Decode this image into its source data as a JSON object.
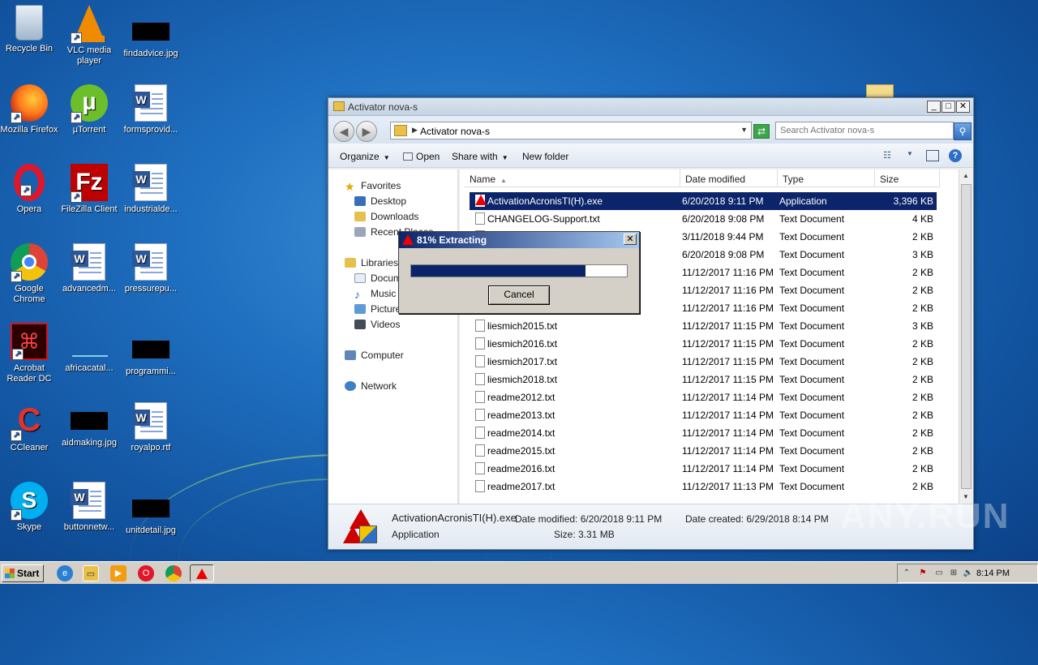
{
  "desktop": {
    "icons": [
      {
        "label": "Recycle Bin"
      },
      {
        "label": "VLC media player"
      },
      {
        "label": "findadvice.jpg"
      },
      {
        "label": "Mozilla Firefox"
      },
      {
        "label": "µTorrent"
      },
      {
        "label": "formsprovid..."
      },
      {
        "label": "Opera"
      },
      {
        "label": "FileZilla Client"
      },
      {
        "label": "industrialde..."
      },
      {
        "label": "Google Chrome"
      },
      {
        "label": "advancedm..."
      },
      {
        "label": "pressurepu..."
      },
      {
        "label": "Acrobat Reader DC"
      },
      {
        "label": "africacatal..."
      },
      {
        "label": "programmi..."
      },
      {
        "label": "CCleaner"
      },
      {
        "label": "aidmaking.jpg"
      },
      {
        "label": "royalpo.rtf"
      },
      {
        "label": "Skype"
      },
      {
        "label": "buttonnetw..."
      },
      {
        "label": "unitdetail.jpg"
      }
    ]
  },
  "explorer": {
    "title": "Activator nova-s",
    "address": "Activator nova-s",
    "search_placeholder": "Search Activator nova-s",
    "toolbar": {
      "organize": "Organize",
      "open": "Open",
      "share_with": "Share with",
      "new_folder": "New folder"
    },
    "nav": {
      "favorites": "Favorites",
      "desktop": "Desktop",
      "downloads": "Downloads",
      "recent_places": "Recent Places",
      "libraries": "Libraries",
      "documents": "Docum",
      "music": "Music",
      "pictures": "Picture",
      "videos": "Videos",
      "computer": "Computer",
      "network": "Network"
    },
    "columns": {
      "name": "Name",
      "date": "Date modified",
      "type": "Type",
      "size": "Size"
    },
    "files": [
      {
        "name": "ActivationAcronisTI(H).exe",
        "date": "6/20/2018 9:11 PM",
        "type": "Application",
        "size": "3,396 KB"
      },
      {
        "name": "CHANGELOG-Support.txt",
        "date": "6/20/2018 9:08 PM",
        "type": "Text Document",
        "size": "4 KB"
      },
      {
        "name": "",
        "date": "3/11/2018 9:44 PM",
        "type": "Text Document",
        "size": "2 KB"
      },
      {
        "name": "",
        "date": "6/20/2018 9:08 PM",
        "type": "Text Document",
        "size": "3 KB"
      },
      {
        "name": "",
        "date": "11/12/2017 11:16 PM",
        "type": "Text Document",
        "size": "2 KB"
      },
      {
        "name": "",
        "date": "11/12/2017 11:16 PM",
        "type": "Text Document",
        "size": "2 KB"
      },
      {
        "name": "",
        "date": "11/12/2017 11:16 PM",
        "type": "Text Document",
        "size": "2 KB"
      },
      {
        "name": "liesmich2015.txt",
        "date": "11/12/2017 11:15 PM",
        "type": "Text Document",
        "size": "3 KB"
      },
      {
        "name": "liesmich2016.txt",
        "date": "11/12/2017 11:15 PM",
        "type": "Text Document",
        "size": "2 KB"
      },
      {
        "name": "liesmich2017.txt",
        "date": "11/12/2017 11:15 PM",
        "type": "Text Document",
        "size": "2 KB"
      },
      {
        "name": "liesmich2018.txt",
        "date": "11/12/2017 11:15 PM",
        "type": "Text Document",
        "size": "2 KB"
      },
      {
        "name": "readme2012.txt",
        "date": "11/12/2017 11:14 PM",
        "type": "Text Document",
        "size": "2 KB"
      },
      {
        "name": "readme2013.txt",
        "date": "11/12/2017 11:14 PM",
        "type": "Text Document",
        "size": "2 KB"
      },
      {
        "name": "readme2014.txt",
        "date": "11/12/2017 11:14 PM",
        "type": "Text Document",
        "size": "2 KB"
      },
      {
        "name": "readme2015.txt",
        "date": "11/12/2017 11:14 PM",
        "type": "Text Document",
        "size": "2 KB"
      },
      {
        "name": "readme2016.txt",
        "date": "11/12/2017 11:14 PM",
        "type": "Text Document",
        "size": "2 KB"
      },
      {
        "name": "readme2017.txt",
        "date": "11/12/2017 11:13 PM",
        "type": "Text Document",
        "size": "2 KB"
      }
    ],
    "details": {
      "name": "ActivationAcronisTI(H).exe",
      "date_modified": "Date modified: 6/20/2018 9:11 PM",
      "date_created": "Date created: 6/29/2018 8:14 PM",
      "type": "Application",
      "size": "Size: 3.31 MB"
    }
  },
  "dialog": {
    "title": "81% Extracting",
    "progress": 0.81,
    "cancel": "Cancel",
    "close": "✕"
  },
  "taskbar": {
    "start": "Start",
    "clock": "8:14 PM"
  },
  "watermark": "ANY.RUN"
}
